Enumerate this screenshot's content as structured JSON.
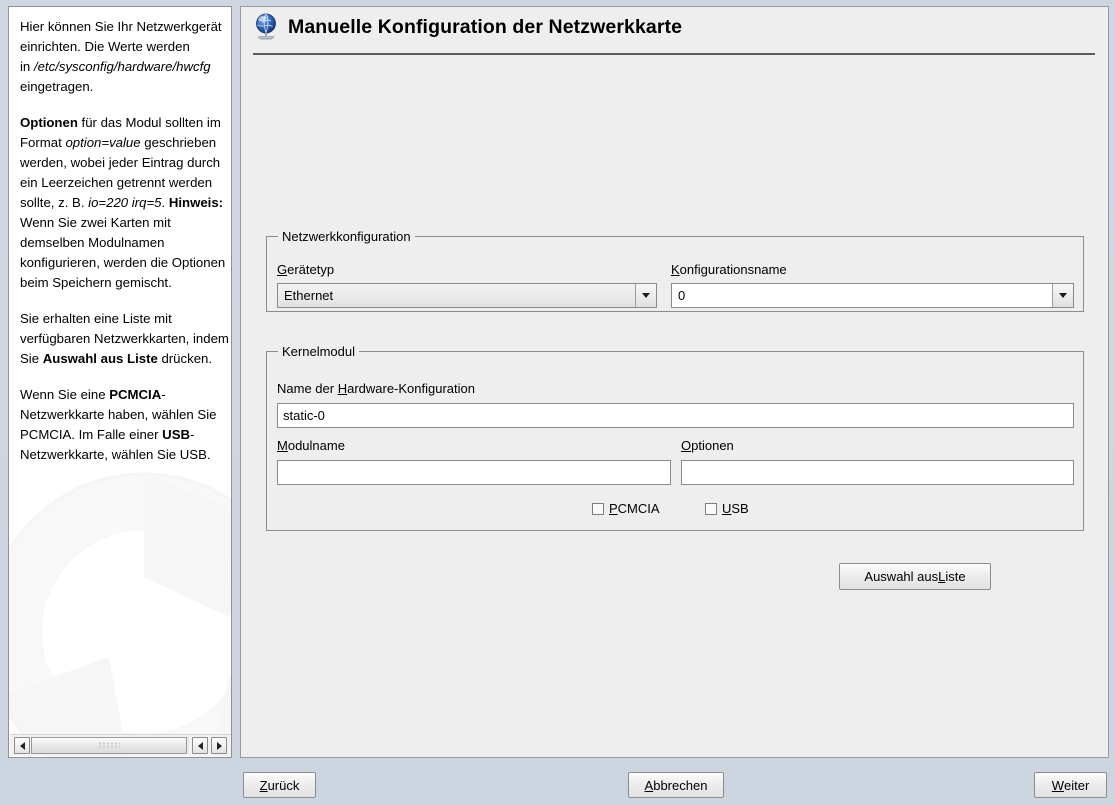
{
  "window": {
    "title": "Manuelle Konfiguration der Netzwerkkarte",
    "title_icon": "network-globe-icon"
  },
  "help": {
    "paragraphs": [
      {
        "id": "p1",
        "runs": [
          {
            "text": "Hier können Sie Ihr Netzwerkgerät einrichten. Die Werte werden",
            "style": "normal"
          },
          {
            "text": "in ",
            "style": "normal"
          },
          {
            "text": "/etc/sysconfig/hardware/hwcfg",
            "style": "italic"
          },
          {
            "text": " eingetragen.",
            "style": "normal"
          }
        ]
      },
      {
        "id": "p2",
        "runs": [
          {
            "text": "Optionen",
            "style": "bold"
          },
          {
            "text": " für das Modul sollten im Format ",
            "style": "normal"
          },
          {
            "text": "option=value",
            "style": "italic"
          },
          {
            "text": " geschrieben werden, wobei jeder Eintrag durch ein Leerzeichen getrennt werden sollte, z. B. ",
            "style": "normal"
          },
          {
            "text": "io=220 irq=5",
            "style": "italic"
          },
          {
            "text": ". ",
            "style": "normal"
          },
          {
            "text": "Hinweis:",
            "style": "bold"
          },
          {
            "text": " Wenn Sie zwei Karten mit demselben Modulnamen konfigurieren, werden die Optionen beim Speichern gemischt.",
            "style": "normal"
          }
        ]
      },
      {
        "id": "p3",
        "runs": [
          {
            "text": "Sie erhalten eine Liste mit verfügbaren Netzwerkkarten, indem Sie ",
            "style": "normal"
          },
          {
            "text": "Auswahl aus Liste",
            "style": "bold"
          },
          {
            "text": " drücken.",
            "style": "normal"
          }
        ]
      },
      {
        "id": "p4",
        "runs": [
          {
            "text": "Wenn Sie eine ",
            "style": "normal"
          },
          {
            "text": "PCMCIA",
            "style": "bold"
          },
          {
            "text": "-Netzwerkkarte haben, wählen Sie PCMCIA. Im Falle einer ",
            "style": "normal"
          },
          {
            "text": "USB",
            "style": "bold"
          },
          {
            "text": "-Netzwerkkarte, wählen Sie USB.",
            "style": "normal"
          }
        ]
      }
    ],
    "scrollbar": {
      "left_arrow_icon": "triangle-left-icon",
      "right_arrow_icon": "triangle-right-icon",
      "end_left_arrow_icon": "triangle-left-icon",
      "end_right_arrow_icon": "triangle-right-icon"
    }
  },
  "form": {
    "network_group": {
      "legend": "Netzwerkkonfiguration",
      "device_type": {
        "label_prefix": "",
        "label_mnemonic": "G",
        "label_suffix": "erätetyp",
        "value": "Ethernet",
        "dropdown_icon": "chevron-down-icon"
      },
      "config_name": {
        "label_prefix": "",
        "label_mnemonic": "K",
        "label_suffix": "onfigurationsname",
        "value": "0",
        "dropdown_icon": "chevron-down-icon"
      }
    },
    "kernel_group": {
      "legend": "Kernelmodul",
      "hardware_config_name": {
        "label_prefix": "Name der ",
        "label_mnemonic": "H",
        "label_suffix": "ardware-Konfiguration",
        "value": "static-0",
        "placeholder": ""
      },
      "module_name": {
        "label_prefix": "",
        "label_mnemonic": "M",
        "label_suffix": "odulname",
        "value": "",
        "placeholder": ""
      },
      "options": {
        "label_prefix": "",
        "label_mnemonic": "O",
        "label_suffix": "ptionen",
        "value": "",
        "placeholder": ""
      },
      "pcmcia_checkbox": {
        "label_prefix": "",
        "label_mnemonic": "P",
        "label_suffix": "CMCIA",
        "checked": false
      },
      "usb_checkbox": {
        "label_prefix": "",
        "label_mnemonic": "U",
        "label_suffix": "SB",
        "checked": false
      }
    },
    "select_from_list_button": {
      "prefix": "Auswahl aus ",
      "mnemonic": "L",
      "suffix": "iste"
    }
  },
  "footer": {
    "back_button": {
      "prefix": "",
      "mnemonic": "Z",
      "suffix": "urück"
    },
    "cancel_button": {
      "prefix": "",
      "mnemonic": "A",
      "suffix": "bbrechen"
    },
    "next_button": {
      "prefix": "",
      "mnemonic": "W",
      "suffix": "eiter"
    }
  },
  "colors": {
    "window_bg": "#cdd6e0",
    "panel_bg": "#eeeeee",
    "help_bg": "#ffffff",
    "border": "#8d8d8d",
    "text": "#000000"
  }
}
